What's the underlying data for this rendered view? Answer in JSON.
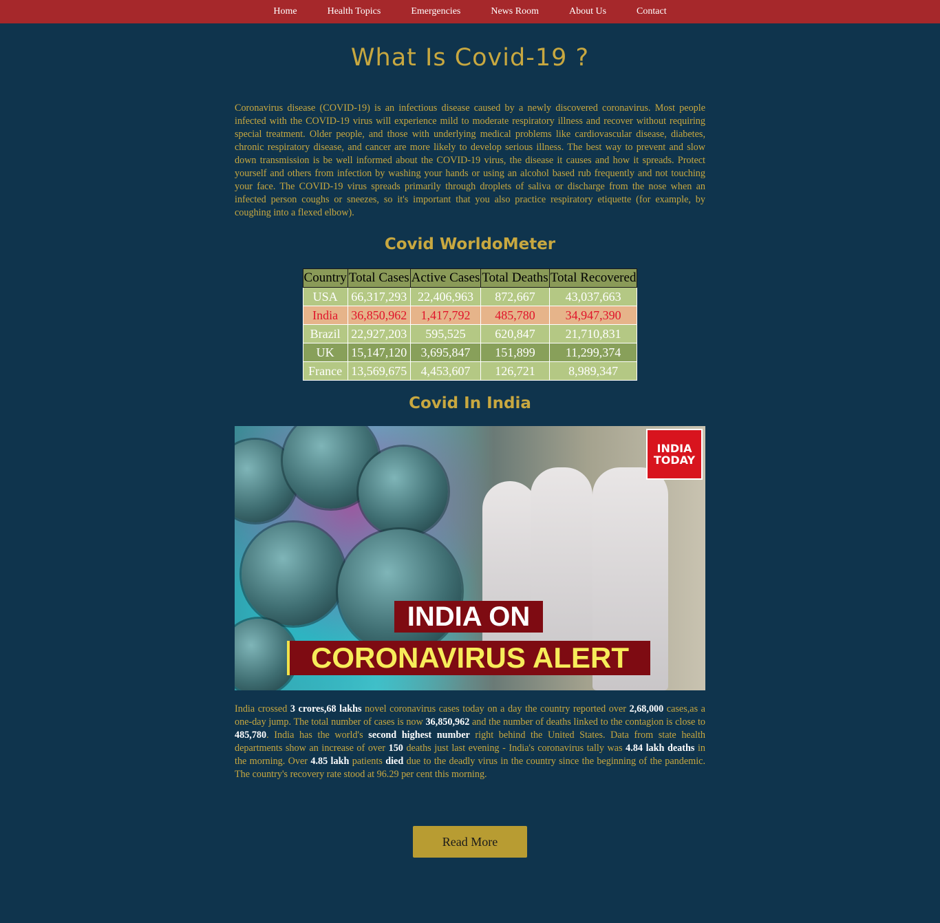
{
  "nav": {
    "items": [
      "Home",
      "Health Topics",
      "Emergencies",
      "News Room",
      "About Us",
      "Contact"
    ]
  },
  "page": {
    "title": "What Is Covid-19 ?",
    "intro": "Coronavirus disease (COVID-19) is an infectious disease caused by a newly discovered coronavirus. Most people infected with the COVID-19 virus will experience mild to moderate respiratory illness and recover without requiring special treatment. Older people, and those with underlying medical problems like cardiovascular disease, diabetes, chronic respiratory disease, and cancer are more likely to develop serious illness. The best way to prevent and slow down transmission is be well informed about the COVID-19 virus, the disease it causes and how it spreads. Protect yourself and others from infection by washing your hands or using an alcohol based rub frequently and not touching your face. The COVID-19 virus spreads primarily through droplets of saliva or discharge from the nose when an infected person coughs or sneezes, so it's important that you also practice respiratory etiquette (for example, by coughing into a flexed elbow)."
  },
  "worldometer": {
    "heading": "Covid WorldoMeter",
    "columns": [
      "Country",
      "Total Cases",
      "Active Cases",
      "Total Deaths",
      "Total Recovered"
    ],
    "rows": [
      [
        "USA",
        "66,317,293",
        "22,406,963",
        "872,667",
        "43,037,663"
      ],
      [
        "India",
        "36,850,962",
        "1,417,792",
        "485,780",
        "34,947,390"
      ],
      [
        "Brazil",
        "22,927,203",
        "595,525",
        "620,847",
        "21,710,831"
      ],
      [
        "UK",
        "15,147,120",
        "3,695,847",
        "151,899",
        "11,299,374"
      ],
      [
        "France",
        "13,569,675",
        "4,453,607",
        "126,721",
        "8,989,347"
      ]
    ]
  },
  "india": {
    "heading": "Covid In India",
    "image": {
      "logo_line1": "INDIA",
      "logo_line2": "TODAY",
      "banner_line1": "INDIA ON",
      "banner_line2": "CORONAVIRUS ALERT"
    },
    "text": {
      "t1": "India crossed ",
      "b1": "3 crores,68 lakhs",
      "t2": " novel coronavirus cases today on a day the country reported over ",
      "b2": "2,68,000",
      "t3": " cases,as a one-day jump. The total number of cases is now ",
      "b3": "36,850,962",
      "t4": " and the number of deaths linked to the contagion is close to ",
      "b4": "485,780",
      "t5": ". India has the world's ",
      "b5": "second highest number",
      "t6": " right behind the United States. Data from state health departments show an increase of over ",
      "b6": "150",
      "t7": " deaths just last evening - India's coronavirus tally was ",
      "b7": "4.84 lakh deaths",
      "t8": " in the morning. Over ",
      "b8": "4.85 lakh",
      "t9": " patients ",
      "b9": "died",
      "t10": " due to the deadly virus in the country since the beginning of the pandemic. The country's recovery rate stood at 96.29 per cent this morning."
    }
  },
  "read_more_label": "Read More"
}
